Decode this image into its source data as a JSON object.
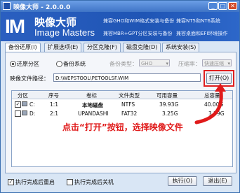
{
  "window": {
    "title": "映像大师 - 2.0.0.0"
  },
  "banner": {
    "logo": "IM",
    "brand_cn": "映像大师",
    "brand_en": "Image Masters",
    "features": [
      "兼容GHO和WIM格式安装与备份",
      "兼容NT5和NT6系统",
      "兼容MBR+GPT分区安装与备份",
      "兼容桌面和EFI环境操作"
    ]
  },
  "tabs": [
    "备份还原(I)",
    "扩展选项(E)",
    "分区克隆(F)",
    "磁盘克隆(D)",
    "系统安装(S)"
  ],
  "options": {
    "restore": "还原分区",
    "backup": "备份系统",
    "backup_type_label": "备份类型：",
    "backup_type_value": "GHO",
    "compress_label": "压缩率：",
    "compress_value": "快速压缩"
  },
  "image_file": {
    "label": "映像文件路径：",
    "value": "D:\\WEPSTOOL\\PETOOLSF.WIM",
    "open_button": "打开(O)"
  },
  "table": {
    "headers": [
      "分区",
      "序号",
      "卷标",
      "文件类型",
      "可用容量",
      "总容量"
    ],
    "rows": [
      {
        "drive": "C:",
        "index": "1:1",
        "label": "本地磁盘",
        "fs": "NTFS",
        "free": "39.93G",
        "total": "40.00G",
        "checked": true
      },
      {
        "drive": "D:",
        "index": "2:1",
        "label": "UPANDASHI",
        "fs": "FAT32",
        "free": "3.25G",
        "total": "3.29G",
        "checked": false
      }
    ]
  },
  "annotation": "点击“打开”按钮，选择映像文件",
  "footer": {
    "reboot_after": "执行完成后重启",
    "shutdown_after": "执行完成后关机",
    "execute_button": "执行(O)",
    "exit_button": "退出(E)"
  },
  "colors": {
    "accent": "#2a5fc0",
    "annotation": "#e01a1a"
  }
}
